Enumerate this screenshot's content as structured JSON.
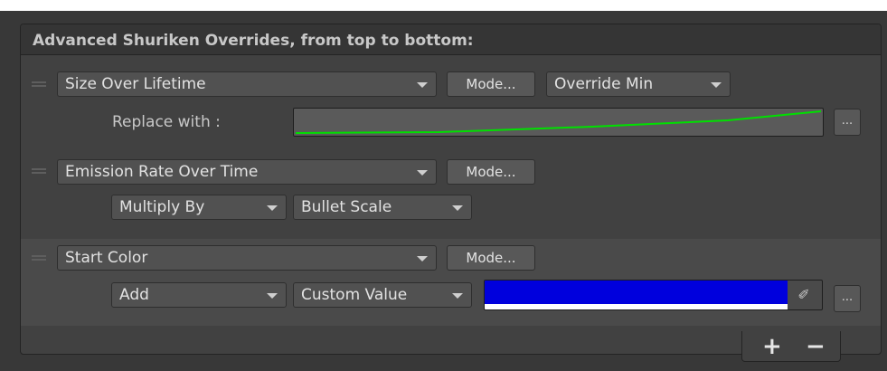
{
  "header": {
    "title": "Advanced Shuriken Overrides, from top to bottom:"
  },
  "items": [
    {
      "property": "Size Over Lifetime",
      "mode_label": "Mode...",
      "override": "Override Min",
      "replace_label": "Replace with :",
      "more_label": "..."
    },
    {
      "property": "Emission Rate Over Time",
      "mode_label": "Mode...",
      "operation": "Multiply By",
      "source": "Bullet Scale"
    },
    {
      "property": "Start Color",
      "mode_label": "Mode...",
      "operation": "Add",
      "source": "Custom Value",
      "color": "#0000dd",
      "more_label": "..."
    }
  ],
  "footer": {
    "add_label": "+",
    "remove_label": "−"
  },
  "colors": {
    "curve_line": "#00e000",
    "swatch_blue": "#0000dd",
    "panel_bg": "#414141",
    "header_bg": "#353535"
  },
  "icons": {
    "drag": "drag-handle-icon",
    "dropdown": "chevron-down-icon",
    "eyedropper": "eyedropper-icon"
  }
}
